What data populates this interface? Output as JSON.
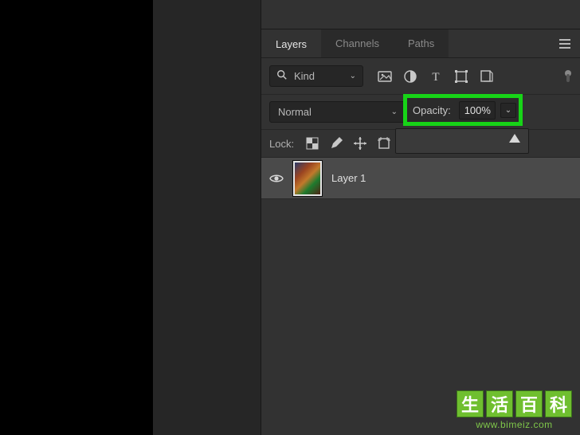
{
  "tabs": {
    "layers": "Layers",
    "channels": "Channels",
    "paths": "Paths"
  },
  "filter": {
    "kind_label": "Kind"
  },
  "blend": {
    "mode": "Normal"
  },
  "opacity": {
    "label": "Opacity:",
    "value": "100%"
  },
  "lock": {
    "label": "Lock:"
  },
  "layers": [
    {
      "name": "Layer 1",
      "visible": true
    }
  ],
  "watermark": {
    "chars": [
      "生",
      "活",
      "百",
      "科"
    ],
    "url": "www.bimeiz.com"
  }
}
